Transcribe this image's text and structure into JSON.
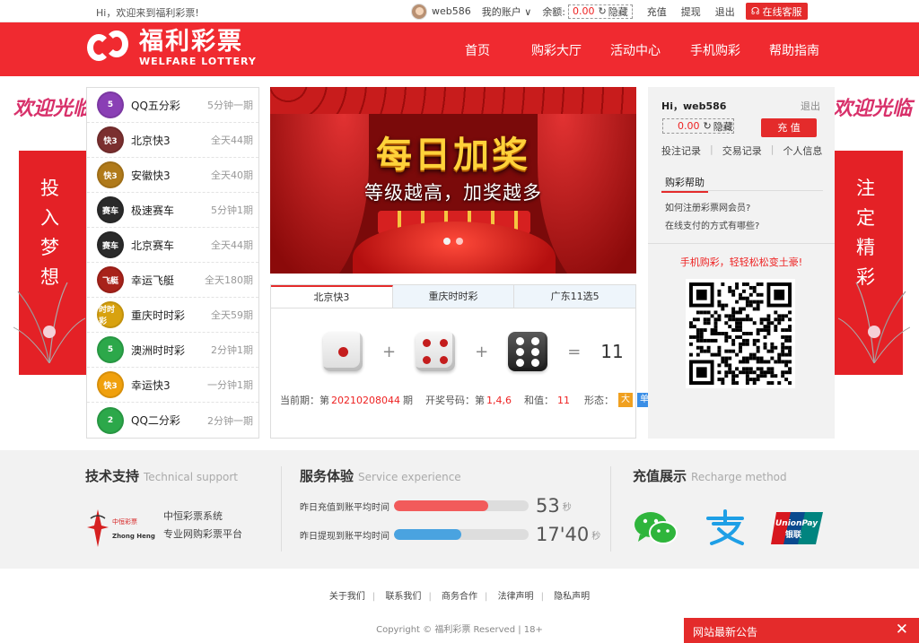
{
  "topbar": {
    "welcome": "Hi，欢迎来到福利彩票!",
    "username": "web586",
    "my_account": "我的账户 ∨",
    "balance_label": "余额:",
    "balance_value": "0.00",
    "hide_label": "隐藏",
    "recharge": "充值",
    "withdraw": "提现",
    "logout": "退出",
    "online_service": "在线客服"
  },
  "header": {
    "logo_cn": "福利彩票",
    "logo_en": "WELFARE LOTTERY",
    "nav": [
      "首页",
      "购彩大厅",
      "活动中心",
      "手机购彩",
      "帮助指南"
    ]
  },
  "side": {
    "left_welcome": "欢迎光临",
    "left_banner": [
      "投",
      "入",
      "梦",
      "想"
    ],
    "right_welcome": "欢迎光临",
    "right_banner": [
      "注",
      "定",
      "精",
      "彩"
    ]
  },
  "lotteries": [
    {
      "name": "QQ五分彩",
      "freq": "5分钟一期",
      "color": "#8a3fb5",
      "badge": "5"
    },
    {
      "name": "北京快3",
      "freq": "全天44期",
      "color": "#7b2f2f",
      "badge": "快3"
    },
    {
      "name": "安徽快3",
      "freq": "全天40期",
      "color": "#b07a1a",
      "badge": "快3"
    },
    {
      "name": "极速赛车",
      "freq": "5分钟1期",
      "color": "#2a2a2a",
      "badge": "赛车"
    },
    {
      "name": "北京赛车",
      "freq": "全天44期",
      "color": "#2a2a2a",
      "badge": "赛车"
    },
    {
      "name": "幸运飞艇",
      "freq": "全天180期",
      "color": "#a8221a",
      "badge": "飞艇"
    },
    {
      "name": "重庆时时彩",
      "freq": "全天59期",
      "color": "#d8a20f",
      "badge": "时时彩"
    },
    {
      "name": "澳洲时时彩",
      "freq": "2分钟1期",
      "color": "#2ca84a",
      "badge": "5"
    },
    {
      "name": "幸运快3",
      "freq": "一分钟1期",
      "color": "#f0a00c",
      "badge": "快3"
    },
    {
      "name": "QQ二分彩",
      "freq": "2分钟一期",
      "color": "#2ca84a",
      "badge": "2"
    }
  ],
  "banner": {
    "title": "每日加奖",
    "subtitle": "等级越高，加奖越多"
  },
  "draw": {
    "tabs": [
      "北京快3",
      "重庆时时彩",
      "广东11选5"
    ],
    "plus": "+",
    "equals": "=",
    "sum": "11",
    "period_label": "当前期：第",
    "period": "20210208044",
    "period_suffix": "期",
    "numbers_label": "开奖号码：第",
    "numbers": "1,4,6",
    "sum_label": "和值：",
    "sum_value": "11",
    "shape_label": "形态：",
    "tag_big": "大",
    "tag_single": "单",
    "tag_big_color": "#f0a020",
    "tag_single_color": "#3a8ee6"
  },
  "user_panel": {
    "hi": "Hi，web586",
    "logout": "退出",
    "balance": "0.00",
    "hide": "隐藏",
    "recharge": "充 值",
    "links": [
      "投注记录",
      "交易记录",
      "个人信息"
    ],
    "help_title": "购彩帮助",
    "questions": [
      "如何注册彩票网会员?",
      "在线支付的方式有哪些?"
    ],
    "mobile_slogan": "手机购彩，轻轻松松变土豪!"
  },
  "footer": {
    "tech_title": "技术支持",
    "tech_en": "Technical support",
    "tech_logo_cn": "中恒彩票",
    "tech_logo_en": "Zhong Heng",
    "tech_line1": "中恒彩票系统",
    "tech_line2": "专业网购彩票平台",
    "service_title": "服务体验",
    "service_en": "Service experience",
    "deposit_label": "昨日充值到账平均时间",
    "deposit_value": "53",
    "deposit_unit": "秒",
    "deposit_fill": 0.7,
    "withdraw_label": "昨日提现到账平均时间",
    "withdraw_value": "17'40",
    "withdraw_unit": "秒",
    "withdraw_fill": 0.5,
    "pay_title": "充值展示",
    "pay_en": "Recharge method",
    "links": [
      "关于我们",
      "联系我们",
      "商务合作",
      "法律声明",
      "隐私声明"
    ],
    "copyright": "Copyright © 福利彩票 Reserved | 18+"
  },
  "notice": {
    "title": "网站最新公告",
    "close": "✕"
  }
}
